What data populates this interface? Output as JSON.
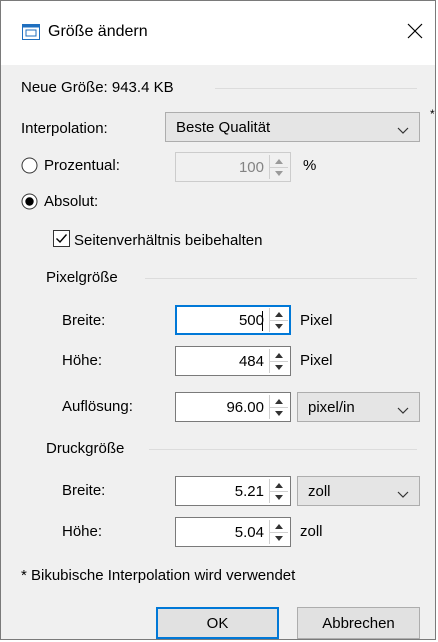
{
  "window": {
    "title": "Größe ändern",
    "close_glyph": "✕"
  },
  "new_size_label": "Neue Größe: 943.4 KB",
  "interpolation": {
    "label": "Interpolation:",
    "value": "Beste Qualität",
    "asterisk": "*"
  },
  "percent": {
    "label": "Prozentual:",
    "value": "100",
    "unit": "%",
    "selected": false
  },
  "absolute": {
    "label": "Absolut:",
    "selected": true
  },
  "keep_ratio": {
    "label": "Seitenverhältnis beibehalten",
    "checked": true
  },
  "pixel_size": {
    "heading": "Pixelgröße",
    "width_label": "Breite:",
    "width_value": "500",
    "width_unit": "Pixel",
    "height_label": "Höhe:",
    "height_value": "484",
    "height_unit": "Pixel",
    "resolution_label": "Auflösung:",
    "resolution_value": "96.00",
    "resolution_unit": "pixel/in"
  },
  "print_size": {
    "heading": "Druckgröße",
    "width_label": "Breite:",
    "width_value": "5.21",
    "width_unit": "zoll",
    "height_label": "Höhe:",
    "height_value": "5.04",
    "height_unit": "zoll"
  },
  "footnote": "* Bikubische Interpolation wird verwendet",
  "buttons": {
    "ok": "OK",
    "cancel": "Abbrechen"
  },
  "colors": {
    "accent": "#0078d7",
    "dialog_bg": "#f0f0f0"
  }
}
